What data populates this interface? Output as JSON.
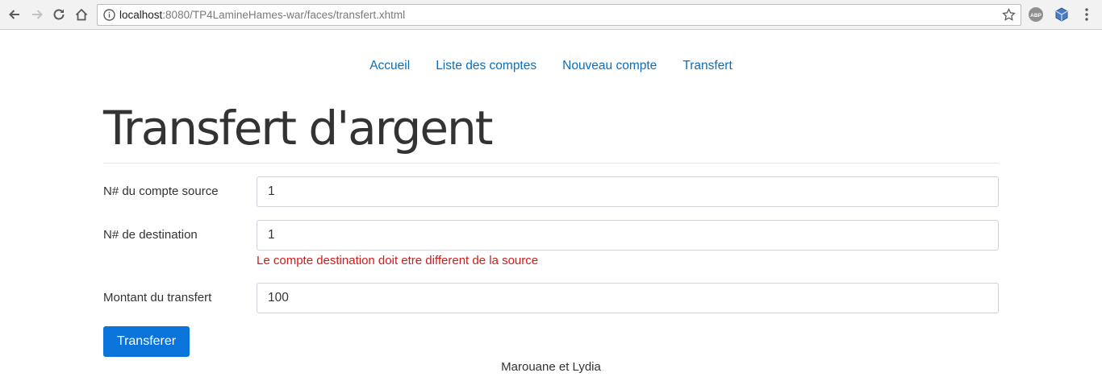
{
  "browser": {
    "url_host": "localhost",
    "url_rest": ":8080/TP4LamineHames-war/faces/transfert.xhtml"
  },
  "nav": {
    "items": [
      "Accueil",
      "Liste des comptes",
      "Nouveau compte",
      "Transfert"
    ]
  },
  "page": {
    "title": "Transfert d'argent"
  },
  "form": {
    "source_label": "N# du compte source",
    "source_value": "1",
    "destination_label": "N# de destination",
    "destination_value": "1",
    "destination_error": "Le compte destination doit etre different de la source",
    "amount_label": "Montant du transfert",
    "amount_value": "100",
    "submit_label": "Transferer"
  },
  "footer": {
    "text": "Marouane et Lydia"
  },
  "colors": {
    "link": "#0a6ebd",
    "primary_button": "#0a74da",
    "error": "#d11a1a"
  }
}
